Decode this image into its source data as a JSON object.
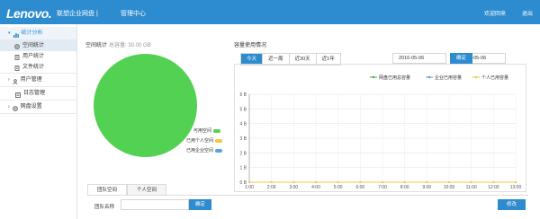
{
  "header": {
    "logo": "Lenovo.",
    "brand": "联想企业网盘 |",
    "section": "管理中心",
    "right": [
      "欢迎回来",
      "退出"
    ]
  },
  "sidebar": {
    "items": [
      {
        "label": "统计分析",
        "type": "group",
        "expanded": true,
        "icon": "chart-icon"
      },
      {
        "label": "空间统计",
        "type": "sub",
        "active": true,
        "icon": "gear-icon"
      },
      {
        "label": "用户统计",
        "type": "sub",
        "icon": "document-icon"
      },
      {
        "label": "文件统计",
        "type": "sub",
        "icon": "document-icon"
      },
      {
        "label": "用户管理",
        "type": "group",
        "icon": "user-icon"
      },
      {
        "label": "日志管理",
        "type": "group",
        "icon": "log-icon"
      },
      {
        "label": "网盘设置",
        "type": "group",
        "icon": "gear-icon"
      }
    ]
  },
  "space": {
    "title": "空间统计",
    "total": "总容量: 30.00 GB",
    "legend": [
      {
        "label": "可用空间",
        "color": "#52d152"
      },
      {
        "label": "已用个人空间",
        "color": "#f5c842"
      },
      {
        "label": "已用企业空间",
        "color": "#5aa0e6"
      }
    ]
  },
  "usage": {
    "title": "容量使用情况",
    "ranges": [
      "今天",
      "近一周",
      "近30天",
      "近1年"
    ],
    "active_range": "今天",
    "date_from": "2016-05-06",
    "date_sep": "-",
    "date_to": "2016-05-06",
    "confirm": "确定"
  },
  "chart_data": {
    "type": "line",
    "x": [
      "1:00",
      "2:00",
      "3:00",
      "4:00",
      "5:00",
      "6:00",
      "7:00",
      "8:00",
      "9:00",
      "10:00",
      "11:00",
      "12:00",
      "13:00"
    ],
    "ylim": [
      0,
      6
    ],
    "yticks": [
      "0 B",
      "1 B",
      "2 B",
      "3 B",
      "4 B",
      "5 B",
      "6 B"
    ],
    "series": [
      {
        "name": "网盘已用总容量",
        "color": "#52b152",
        "values": [
          0,
          0,
          0,
          0,
          0,
          0,
          0,
          0,
          0,
          0,
          0,
          0,
          0
        ]
      },
      {
        "name": "企业已用容量",
        "color": "#5aa0e6",
        "values": [
          0,
          0,
          0,
          0,
          0,
          0,
          0,
          0,
          0,
          0,
          0,
          0,
          0
        ]
      },
      {
        "name": "个人已用容量",
        "color": "#f5c842",
        "values": [
          0,
          0,
          0,
          0,
          0,
          0,
          0,
          0,
          0,
          0,
          0,
          0,
          0
        ]
      }
    ],
    "grid": true,
    "legend": "top-right"
  },
  "bottom": {
    "tabs": [
      "团队空间",
      "个人空间"
    ],
    "active_tab": "团队空间",
    "team_name_label": "团队名称",
    "confirm": "确定",
    "right_button": "修改"
  }
}
